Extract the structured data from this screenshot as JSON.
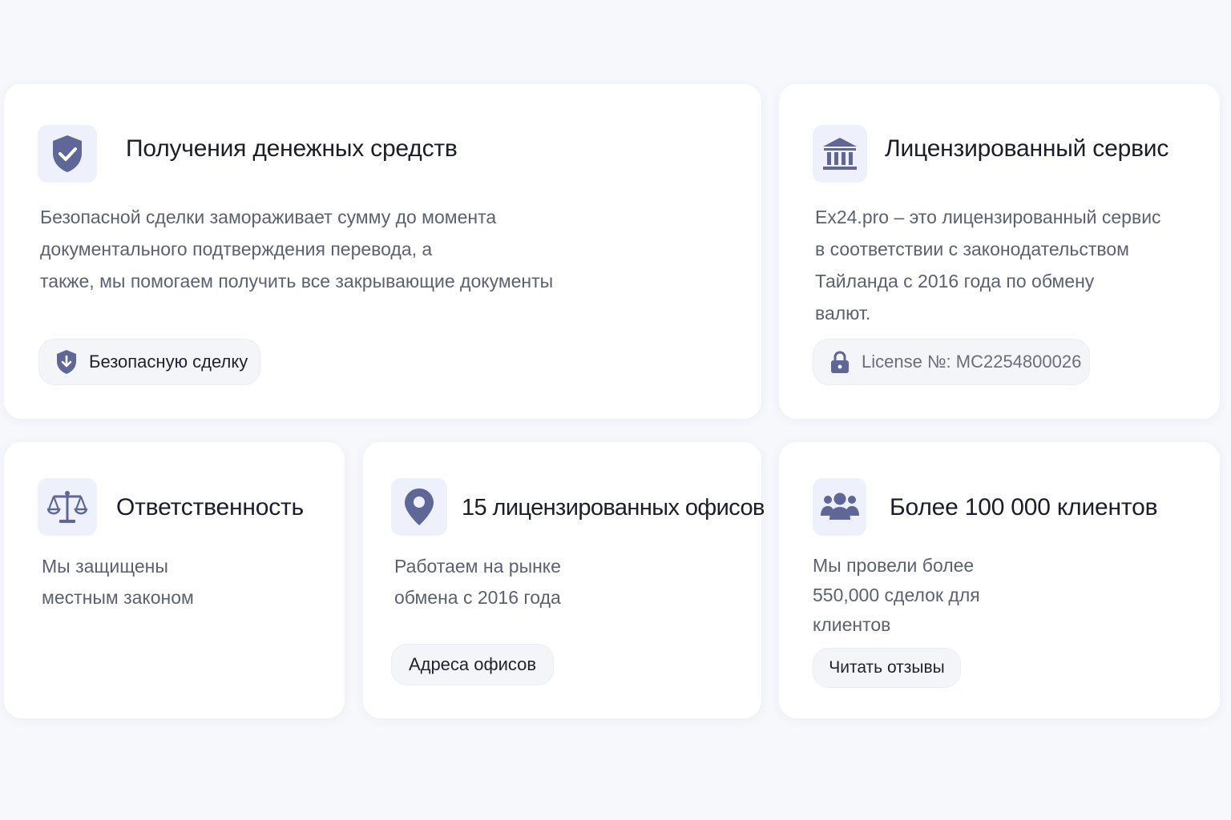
{
  "colors": {
    "accent": "#5f6797",
    "card_bg": "#ffffff",
    "page_bg": "#f7f8fc",
    "icon_bg": "#eef0fb"
  },
  "cards": {
    "funds": {
      "icon": "shield-check-icon",
      "title": "Получения денежных средств",
      "description": "Безопасной сделки замораживает сумму до момента\nдокументального подтверждения перевода, а\nтакже, мы помогаем получить все закрывающие документы",
      "button": {
        "icon": "shield-down-icon",
        "label": "Безопасную сделку"
      }
    },
    "licensed": {
      "icon": "bank-icon",
      "title": "Лицензированный сервис",
      "description": "Ex24.pro – это лицензированный сервис\nв соответствии с законодательством\nТайланда с 2016 года по обмену\nвалют.",
      "license": {
        "icon": "lock-icon",
        "label": "License №: MC2254800026"
      }
    },
    "responsibility": {
      "icon": "scales-icon",
      "title": "Ответственность",
      "description": "Мы защищены\nместным законом"
    },
    "offices": {
      "icon": "location-pin-icon",
      "title": "15 лицензированных офисов",
      "description": "Работаем на рынке\nобмена с 2016 года",
      "button": {
        "label": "Адреса офисов"
      }
    },
    "clients": {
      "icon": "users-icon",
      "title": "Более 100 000 клиентов",
      "description": "Мы провели более\n550,000 сделок для\nклиентов",
      "button": {
        "label": "Читать отзывы"
      }
    }
  }
}
